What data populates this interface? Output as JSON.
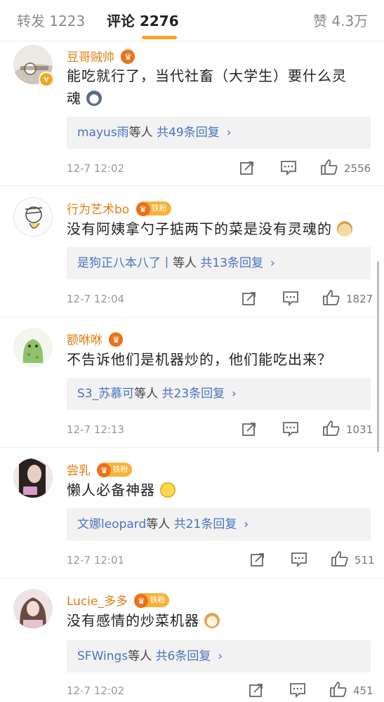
{
  "tabs": {
    "repost_label": "转发",
    "repost_count": "1223",
    "comments_label": "评论",
    "comments_count": "2276",
    "likes_label": "赞",
    "likes_count": "4.3万"
  },
  "comments": [
    {
      "username": "豆哥贼帅",
      "fan_badge": "",
      "text_line1": "能吃就行了，当代社畜（大学生）要什么灵",
      "text_line2": "魂",
      "reply_who": "mayus雨",
      "reply_mid": "等人",
      "reply_count": "共49条回复",
      "time": "12-7 12:02",
      "likes": "2556"
    },
    {
      "username": "行为艺术bo",
      "fan_badge": "铁粉",
      "text_line1": "没有阿姨拿勺子掂两下的菜是没有灵魂的",
      "reply_who": "是狗正八本八了丨",
      "reply_mid": "等人",
      "reply_count": "共13条回复",
      "time": "12-7 12:04",
      "likes": "1827"
    },
    {
      "username": "额咻咻",
      "fan_badge": "",
      "text_line1": "不告诉他们是机器炒的，他们能吃出来？",
      "reply_who": "S3_苏慕可",
      "reply_mid": "等人",
      "reply_count": "共23条回复",
      "time": "12-7 12:13",
      "likes": "1031"
    },
    {
      "username": "尝乳",
      "fan_badge": "铁粉",
      "text_line1": "懒人必备神器",
      "reply_who": "文娜leopard",
      "reply_mid": "等人",
      "reply_count": "共21条回复",
      "time": "12-7 12:01",
      "likes": "511"
    },
    {
      "username": "Lucie_多多",
      "fan_badge": "铁粉",
      "text_line1": "没有感情的炒菜机器",
      "reply_who": "SFWings",
      "reply_mid": "等人",
      "reply_count": "共6条回复",
      "time": "12-7 12:02",
      "likes": "451"
    }
  ],
  "icons": {
    "repost": "repost-icon",
    "comment": "comment-icon",
    "like": "like-icon",
    "chevron": "chevron-right-icon"
  },
  "colors": {
    "accent": "#f5a623",
    "username": "#e07d10",
    "link": "#4a74c1"
  }
}
